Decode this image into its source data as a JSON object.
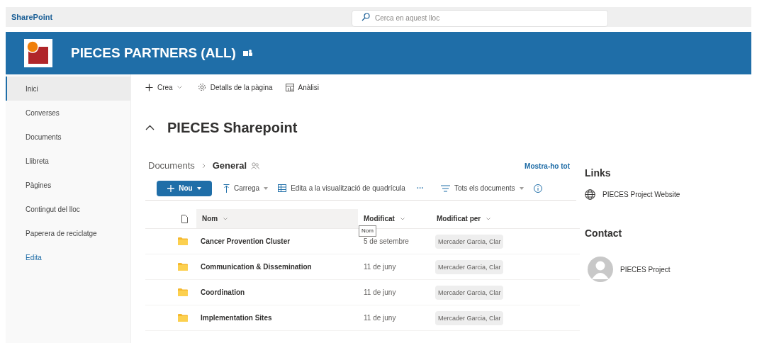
{
  "app_bar": {
    "brand": "SharePoint",
    "search": {
      "placeholder": "Cerca en aquest lloc"
    }
  },
  "site_header": {
    "title": "PIECES PARTNERS (ALL)"
  },
  "sidebar": {
    "items": [
      {
        "label": "Inici",
        "selected": true,
        "kind": "nav"
      },
      {
        "label": "Converses",
        "selected": false,
        "kind": "nav"
      },
      {
        "label": "Documents",
        "selected": false,
        "kind": "nav"
      },
      {
        "label": "Llibreta",
        "selected": false,
        "kind": "nav"
      },
      {
        "label": "Pàgines",
        "selected": false,
        "kind": "nav"
      },
      {
        "label": "Contingut del lloc",
        "selected": false,
        "kind": "nav"
      },
      {
        "label": "Paperera de reciclatge",
        "selected": false,
        "kind": "nav"
      },
      {
        "label": "Edita",
        "selected": false,
        "kind": "link"
      }
    ]
  },
  "command_bar": [
    "Crea",
    "Detalls de la pàgina",
    "Anàlisi"
  ],
  "page_title": "PIECES Sharepoint",
  "library": {
    "breadcrumb": [
      "Documents",
      "General"
    ],
    "show_all": "Mostra-ho tot",
    "toolbar": {
      "new": "Nou",
      "upload": "Carrega",
      "grid_edit": "Edita a la visualització de quadrícula",
      "more": "···",
      "view": "Tots els documents"
    },
    "columns": [
      "Nom",
      "Modificat",
      "Modificat per"
    ],
    "tooltip": "Nom",
    "rows": [
      {
        "name": "Cancer Provention Cluster",
        "modified": "5 de setembre",
        "modified_by": "Mercader Garcia, Clar"
      },
      {
        "name": "Communication & Dissemination",
        "modified": "11 de juny",
        "modified_by": "Mercader Garcia, Clar"
      },
      {
        "name": "Coordination",
        "modified": "11 de juny",
        "modified_by": "Mercader Garcia, Clar"
      },
      {
        "name": "Implementation Sites",
        "modified": "11 de juny",
        "modified_by": "Mercader Garcia, Clar"
      }
    ]
  },
  "links": {
    "title": "Links",
    "items": [
      "PIECES Project Website"
    ]
  },
  "contact": {
    "title": "Contact",
    "people": [
      "PIECES Project"
    ]
  }
}
